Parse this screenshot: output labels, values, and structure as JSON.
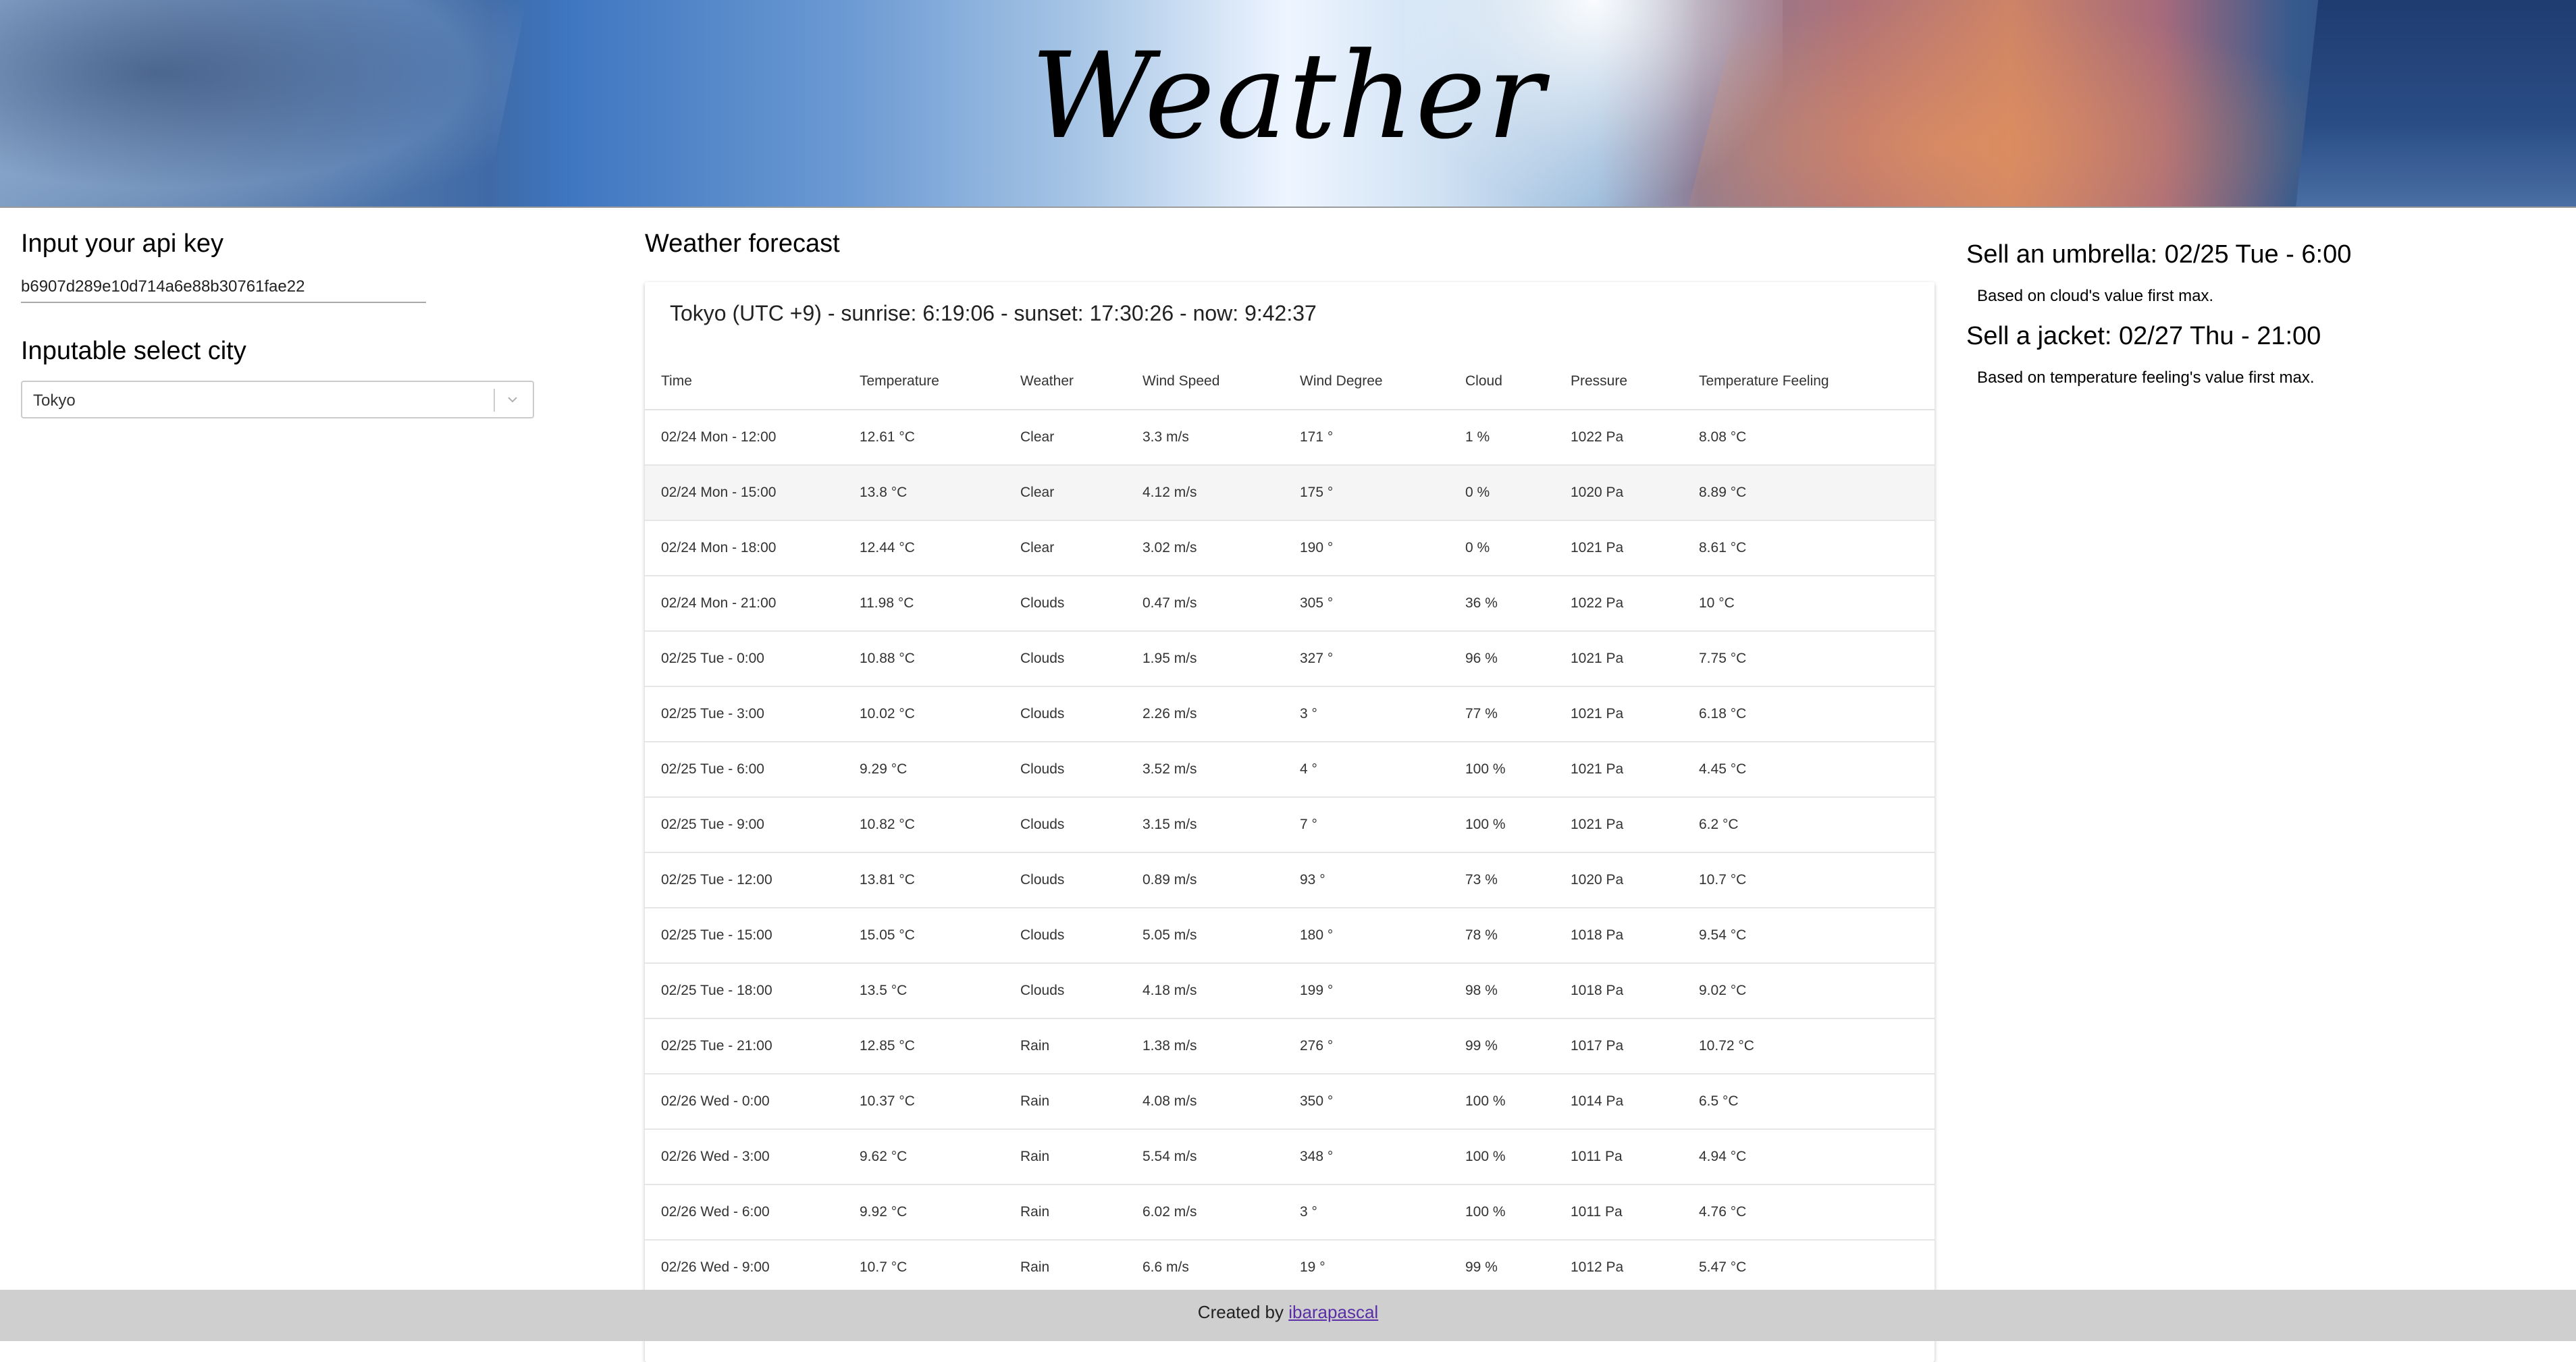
{
  "header": {
    "title": "Weather"
  },
  "api": {
    "title": "Input your api key",
    "value": "b6907d289e10d714a6e88b30761fae22"
  },
  "city": {
    "title": "Inputable select city",
    "selected": "Tokyo"
  },
  "forecast": {
    "title": "Weather forecast",
    "summary": "Tokyo (UTC +9) - sunrise: 6:19:06 - sunset: 17:30:26 - now: 9:42:37",
    "columns": [
      "Time",
      "Temperature",
      "Weather",
      "Wind Speed",
      "Wind Degree",
      "Cloud",
      "Pressure",
      "Temperature Feeling"
    ],
    "rows": [
      [
        "02/24 Mon - 12:00",
        "12.61 °C",
        "Clear",
        "3.3 m/s",
        "171 °",
        "1 %",
        "1022 Pa",
        "8.08 °C"
      ],
      [
        "02/24 Mon - 15:00",
        "13.8 °C",
        "Clear",
        "4.12 m/s",
        "175 °",
        "0 %",
        "1020 Pa",
        "8.89 °C"
      ],
      [
        "02/24 Mon - 18:00",
        "12.44 °C",
        "Clear",
        "3.02 m/s",
        "190 °",
        "0 %",
        "1021 Pa",
        "8.61 °C"
      ],
      [
        "02/24 Mon - 21:00",
        "11.98 °C",
        "Clouds",
        "0.47 m/s",
        "305 °",
        "36 %",
        "1022 Pa",
        "10 °C"
      ],
      [
        "02/25 Tue - 0:00",
        "10.88 °C",
        "Clouds",
        "1.95 m/s",
        "327 °",
        "96 %",
        "1021 Pa",
        "7.75 °C"
      ],
      [
        "02/25 Tue - 3:00",
        "10.02 °C",
        "Clouds",
        "2.26 m/s",
        "3 °",
        "77 %",
        "1021 Pa",
        "6.18 °C"
      ],
      [
        "02/25 Tue - 6:00",
        "9.29 °C",
        "Clouds",
        "3.52 m/s",
        "4 °",
        "100 %",
        "1021 Pa",
        "4.45 °C"
      ],
      [
        "02/25 Tue - 9:00",
        "10.82 °C",
        "Clouds",
        "3.15 m/s",
        "7 °",
        "100 %",
        "1021 Pa",
        "6.2 °C"
      ],
      [
        "02/25 Tue - 12:00",
        "13.81 °C",
        "Clouds",
        "0.89 m/s",
        "93 °",
        "73 %",
        "1020 Pa",
        "10.7 °C"
      ],
      [
        "02/25 Tue - 15:00",
        "15.05 °C",
        "Clouds",
        "5.05 m/s",
        "180 °",
        "78 %",
        "1018 Pa",
        "9.54 °C"
      ],
      [
        "02/25 Tue - 18:00",
        "13.5 °C",
        "Clouds",
        "4.18 m/s",
        "199 °",
        "98 %",
        "1018 Pa",
        "9.02 °C"
      ],
      [
        "02/25 Tue - 21:00",
        "12.85 °C",
        "Rain",
        "1.38 m/s",
        "276 °",
        "99 %",
        "1017 Pa",
        "10.72 °C"
      ],
      [
        "02/26 Wed - 0:00",
        "10.37 °C",
        "Rain",
        "4.08 m/s",
        "350 °",
        "100 %",
        "1014 Pa",
        "6.5 °C"
      ],
      [
        "02/26 Wed - 3:00",
        "9.62 °C",
        "Rain",
        "5.54 m/s",
        "348 °",
        "100 %",
        "1011 Pa",
        "4.94 °C"
      ],
      [
        "02/26 Wed - 6:00",
        "9.92 °C",
        "Rain",
        "6.02 m/s",
        "3 °",
        "100 %",
        "1011 Pa",
        "4.76 °C"
      ],
      [
        "02/26 Wed - 9:00",
        "10.7 °C",
        "Rain",
        "6.6 m/s",
        "19 °",
        "99 %",
        "1012 Pa",
        "5.47 °C"
      ]
    ]
  },
  "advice": {
    "umbrella_title": "Sell an umbrella: 02/25 Tue - 6:00",
    "umbrella_note": "Based on cloud's value first max.",
    "jacket_title": "Sell a jacket: 02/27 Thu - 21:00",
    "jacket_note": "Based on temperature feeling's value first max."
  },
  "footer": {
    "prefix": "Created by ",
    "link": "ibarapascal"
  }
}
